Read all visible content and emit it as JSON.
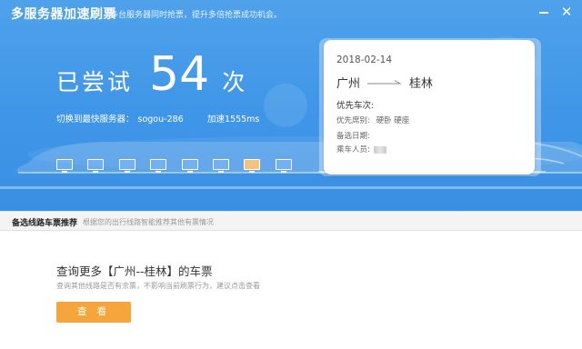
{
  "header": {
    "title": "多服务器加速刷票",
    "subtitle": "多台服务器同时抢票，提升多倍抢票成功机会。"
  },
  "attempt": {
    "prefix": "已尝试",
    "count": "54",
    "suffix": "次"
  },
  "server": {
    "label": "切换到最快服务器：",
    "name": "sogou-286",
    "speed": "加速1555ms"
  },
  "servers": {
    "total": 8,
    "active_index": 6,
    "icon": "monitor-icon",
    "active_color": "#f6c27a"
  },
  "ticket": {
    "date": "2018-02-14",
    "from": "广州",
    "to": "桂林",
    "priority_train_label": "优先车次:",
    "priority_seat_label": "优先席别:",
    "priority_seats": "硬卧  硬座",
    "backup_date_label": "备选日期:",
    "passenger_label": "乘车人员:"
  },
  "subbar": {
    "title": "备选线路车票推荐",
    "desc": "根据您的出行线路智能推荐其他有票情况"
  },
  "query": {
    "title": "查询更多【广州--桂林】的车票",
    "desc": "查询其他线路是否有余票，不影响当前刷票行为，建议点击查看",
    "button": "查 看"
  },
  "colors": {
    "hero_blue": "#4fa1ea",
    "button_orange": "#f6a53d"
  }
}
